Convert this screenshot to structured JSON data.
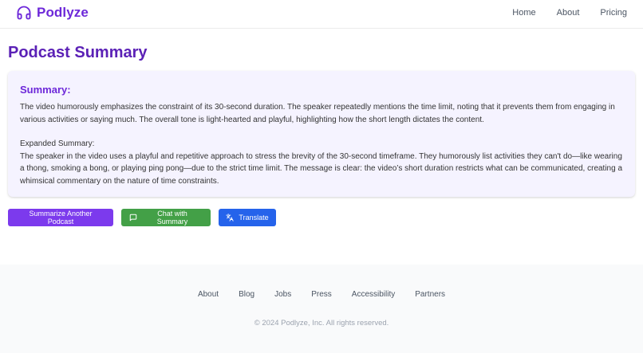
{
  "brand": {
    "name": "Podlyze",
    "icon": "headphones-icon",
    "color": "#6d28d9"
  },
  "nav": {
    "items": [
      "Home",
      "About",
      "Pricing"
    ]
  },
  "page": {
    "title": "Podcast Summary"
  },
  "summary": {
    "heading": "Summary:",
    "text": "The video humorously emphasizes the constraint of its 30-second duration. The speaker repeatedly mentions the time limit, noting that it prevents them from engaging in various activities or saying much. The overall tone is light-hearted and playful, highlighting how the short length dictates the content.",
    "expanded_label": "Expanded Summary:",
    "expanded_text": "The speaker in the video uses a playful and repetitive approach to stress the brevity of the 30-second timeframe. They humorously list activities they can't do—like wearing a thong, smoking a bong, or playing ping pong—due to the strict time limit. The message is clear: the video’s short duration restricts what can be communicated, creating a whimsical commentary on the nature of time constraints."
  },
  "actions": {
    "summarize": {
      "label": "Summarize Another Podcast",
      "color": "#7c3aed"
    },
    "chat": {
      "label": "Chat with Summary",
      "icon": "chat-icon",
      "color": "#43a047"
    },
    "translate": {
      "label": "Translate",
      "icon": "translate-icon",
      "color": "#2563eb"
    }
  },
  "footer": {
    "links": [
      "About",
      "Blog",
      "Jobs",
      "Press",
      "Accessibility",
      "Partners"
    ],
    "copyright": "© 2024 Podlyze, Inc. All rights reserved."
  }
}
